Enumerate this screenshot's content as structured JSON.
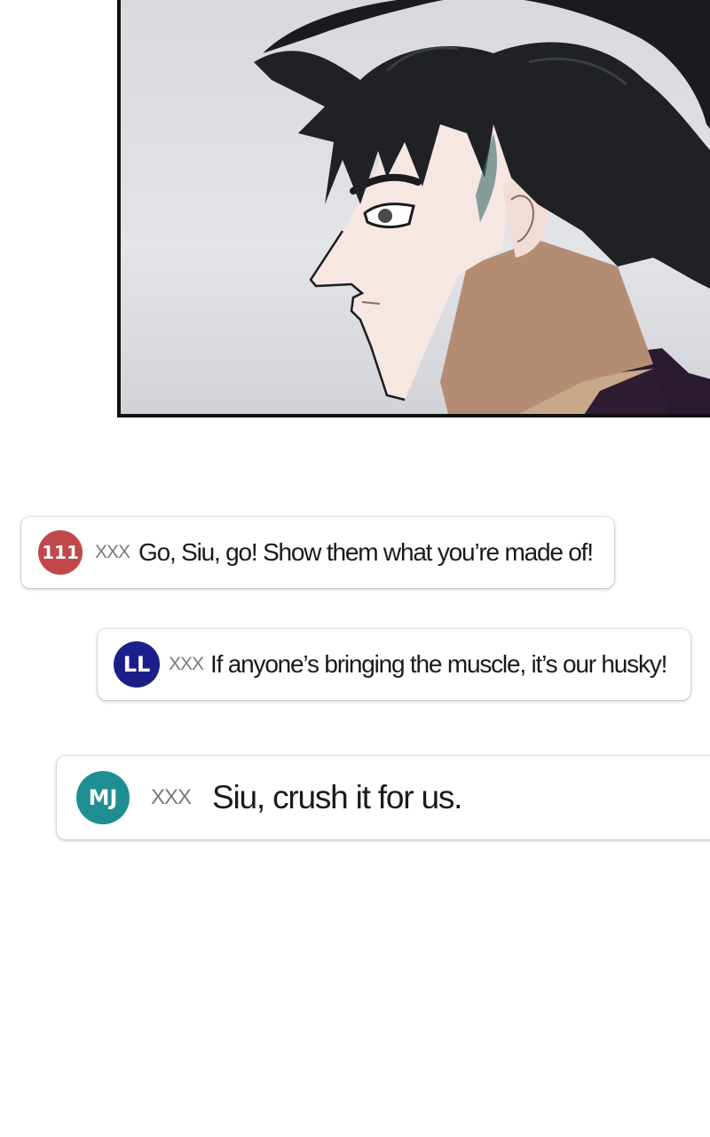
{
  "panel": {
    "description_name": "comic-panel"
  },
  "comments": [
    {
      "avatar": "111",
      "avatar_color": "#c0474a",
      "user": "XXX",
      "message": "Go, Siu, go! Show them what you’re made of!"
    },
    {
      "avatar": "LL",
      "avatar_color": "#1c1f8a",
      "user": "XXX",
      "message": "If anyone’s bringing the muscle, it’s our husky!"
    },
    {
      "avatar": "MJ",
      "avatar_color": "#1e8e92",
      "user": "XXX",
      "message": "Siu, crush it for us."
    }
  ]
}
